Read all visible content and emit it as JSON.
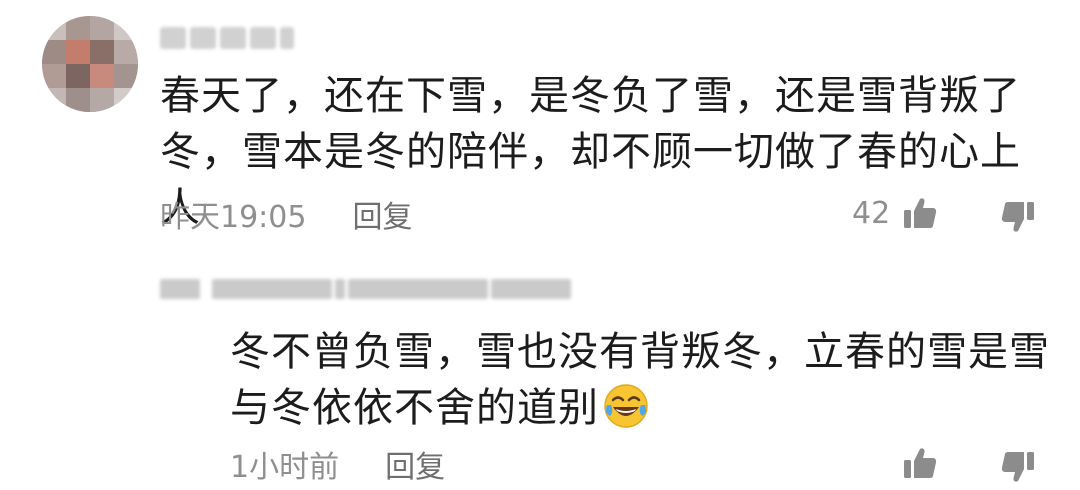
{
  "comment": {
    "username": "",
    "text": "春天了，还在下雪，是冬负了雪，还是雪背叛了冬，雪本是冬的陪伴，却不顾一切做了春的心上人",
    "time": "昨天19:05",
    "reply_label": "回复",
    "like_count": "42"
  },
  "reply": {
    "username": "",
    "text": "冬不曾负雪，雪也没有背叛冬，立春的雪是雪与冬依依不舍的道别",
    "emoji": "laughing-crying-emoji",
    "time": "1小时前",
    "reply_label": "回复"
  },
  "colors": {
    "text": "#1c1c1c",
    "meta": "#8f8f8f",
    "icon": "#8c8c8c"
  }
}
